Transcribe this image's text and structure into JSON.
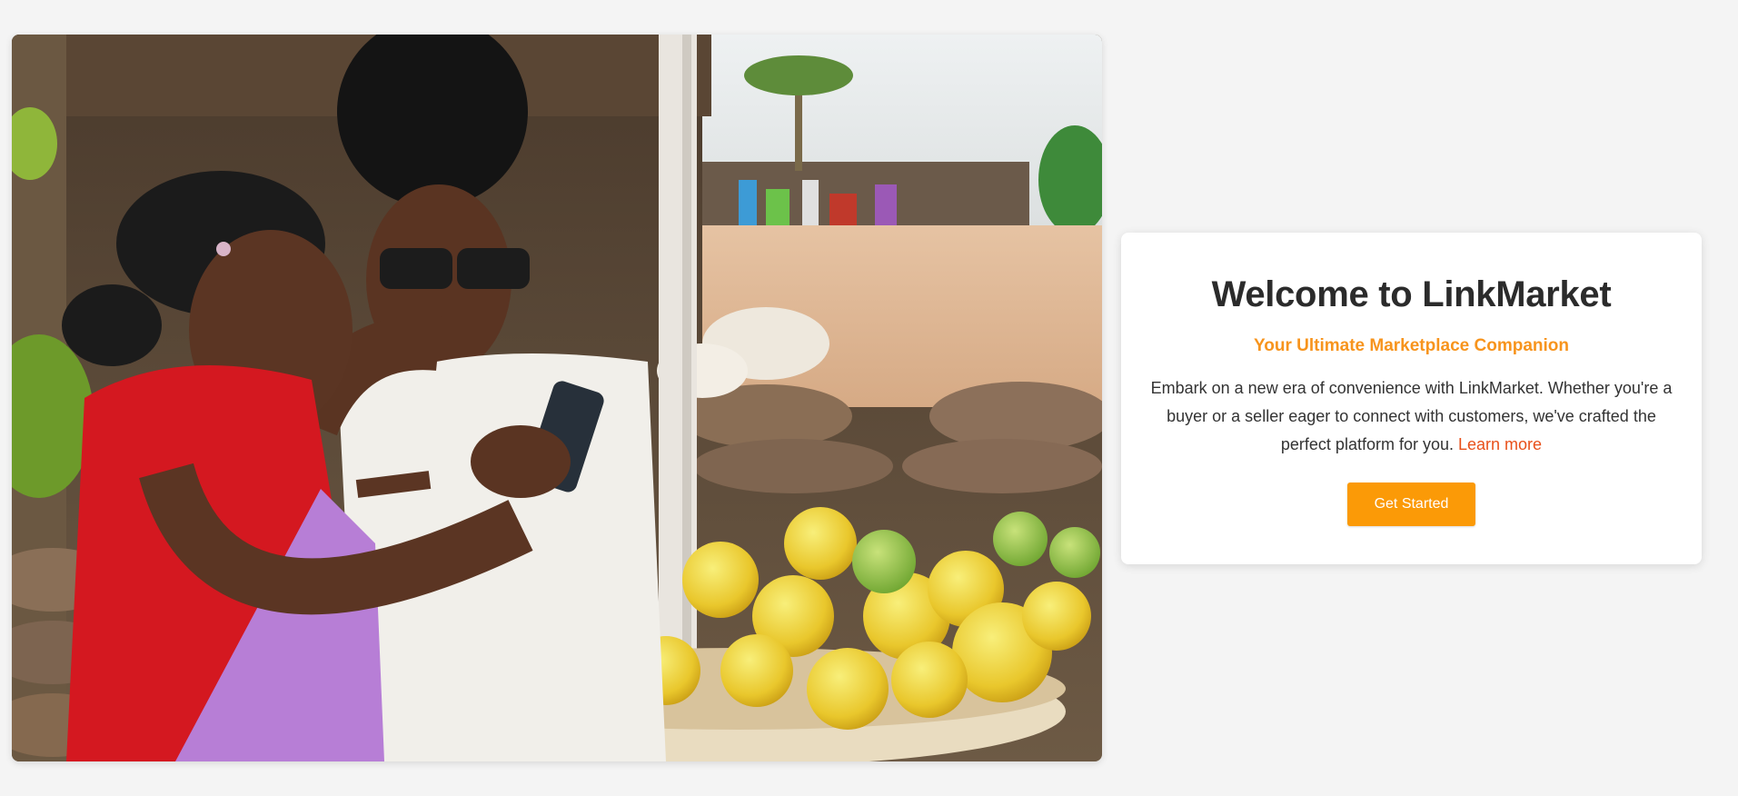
{
  "hero": {
    "image_alt": "Two women at a fruit market looking at a phone"
  },
  "card": {
    "title": "Welcome to LinkMarket",
    "subtitle": "Your Ultimate Marketplace Companion",
    "body": "Embark on a new era of convenience with LinkMarket. Whether you're a buyer or a seller eager to connect with customers, we've crafted the perfect platform for you.",
    "learn_more_label": "Learn more",
    "cta_label": "Get Started"
  },
  "colors": {
    "background": "#f4f4f4",
    "accent": "#fb9a07",
    "subtitle": "#f7941d",
    "link": "#e8501a",
    "title": "#2b2b2b"
  }
}
